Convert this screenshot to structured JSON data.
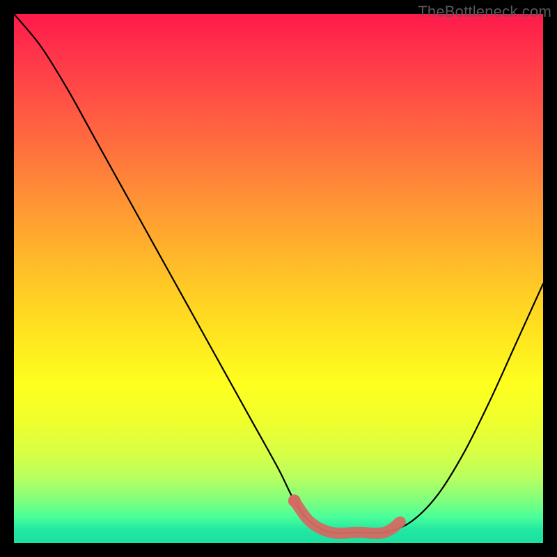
{
  "watermark": "TheBottleneck.com",
  "colors": {
    "curve": "#000000",
    "highlight": "#d46a63",
    "background": "#000000"
  },
  "chart_data": {
    "type": "line",
    "title": "",
    "xlabel": "",
    "ylabel": "",
    "xlim": [
      0,
      100
    ],
    "ylim": [
      0,
      100
    ],
    "grid": false,
    "legend": false,
    "description": "V-shaped bottleneck curve over a red-to-green vertical gradient; minimum/optimal zone highlighted with a salmon stroke near the bottom.",
    "series": [
      {
        "name": "bottleneck_curve",
        "x": [
          0,
          5,
          10,
          15,
          20,
          25,
          30,
          35,
          40,
          45,
          50,
          53,
          56,
          60,
          65,
          70,
          75,
          80,
          85,
          90,
          95,
          100
        ],
        "y": [
          100,
          94,
          86,
          77,
          68,
          59,
          50,
          41,
          32,
          23,
          14,
          8,
          4,
          2,
          2,
          2,
          4,
          9,
          17,
          27,
          38,
          49
        ]
      }
    ],
    "highlight_region": {
      "name": "optimal-zone",
      "x": [
        53,
        56,
        60,
        65,
        70,
        73
      ],
      "y": [
        8,
        4,
        2,
        2,
        2,
        4
      ]
    },
    "marker": {
      "x": 53,
      "y": 8
    }
  }
}
